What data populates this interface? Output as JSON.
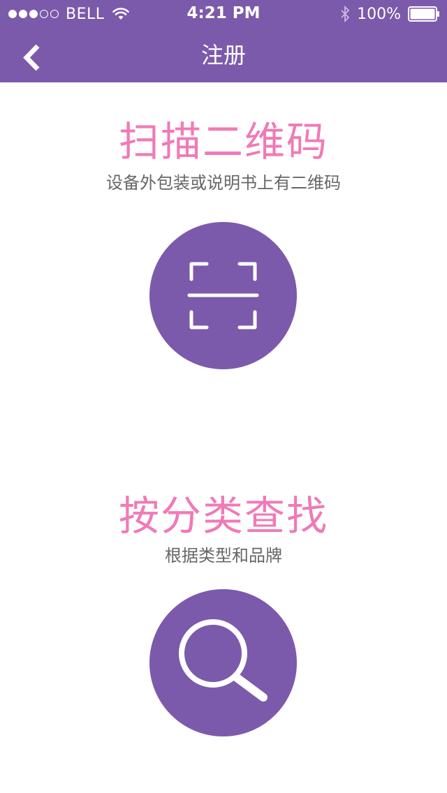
{
  "status_bar": {
    "carrier": "BELL",
    "time": "4:21 PM",
    "battery": "100%",
    "signal_bars_filled": 3,
    "signal_bars_total": 5
  },
  "nav": {
    "title": "注册"
  },
  "scan_section": {
    "title": "扫描二维码",
    "subtitle": "设备外包装或说明书上有二维码"
  },
  "category_section": {
    "title": "按分类查找",
    "subtitle": "根据类型和品牌"
  },
  "icons": {
    "back": "chevron-left-icon",
    "scan": "qr-scan-icon",
    "search": "search-icon"
  },
  "colors": {
    "primary": "#7b5aab",
    "accent": "#f07ab6",
    "subtitle": "#666666"
  }
}
